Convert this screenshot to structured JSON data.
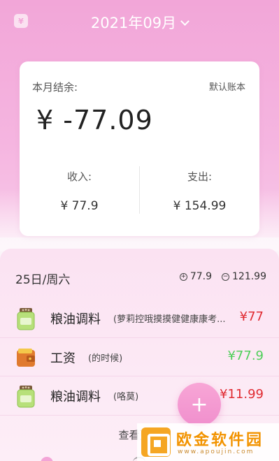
{
  "header": {
    "badge_glyph": "¥",
    "month": "2021年09月"
  },
  "summary": {
    "label": "本月结余:",
    "book_name": "默认账本",
    "balance": "¥ -77.09",
    "income_label": "收入:",
    "income_value": "¥ 77.9",
    "expense_label": "支出:",
    "expense_value": "¥ 154.99"
  },
  "day": {
    "date": "25日/周六",
    "income_sign": "+",
    "income": "77.9",
    "expense_sign": "−",
    "expense": "121.99"
  },
  "records": [
    {
      "category": "粮油调料",
      "note": "(萝莉控哦摸摸健健康康考...",
      "amount": "¥77",
      "type": "expense",
      "icon": "grocery-jar-icon"
    },
    {
      "category": "工资",
      "note": "(的时候)",
      "amount": "¥77.9",
      "type": "income",
      "icon": "wallet-icon"
    },
    {
      "category": "粮油调料",
      "note": "(咯莫)",
      "amount": "¥11.99",
      "type": "expense",
      "icon": "grocery-jar-icon"
    }
  ],
  "more_label": "查看更多",
  "fab_label": "+",
  "colors": {
    "accent": "#f3a5d7",
    "expense": "#e02b32",
    "income": "#4fcf5a"
  },
  "watermark": {
    "text": "欧金软件园",
    "url": "www.apoujin.com"
  }
}
